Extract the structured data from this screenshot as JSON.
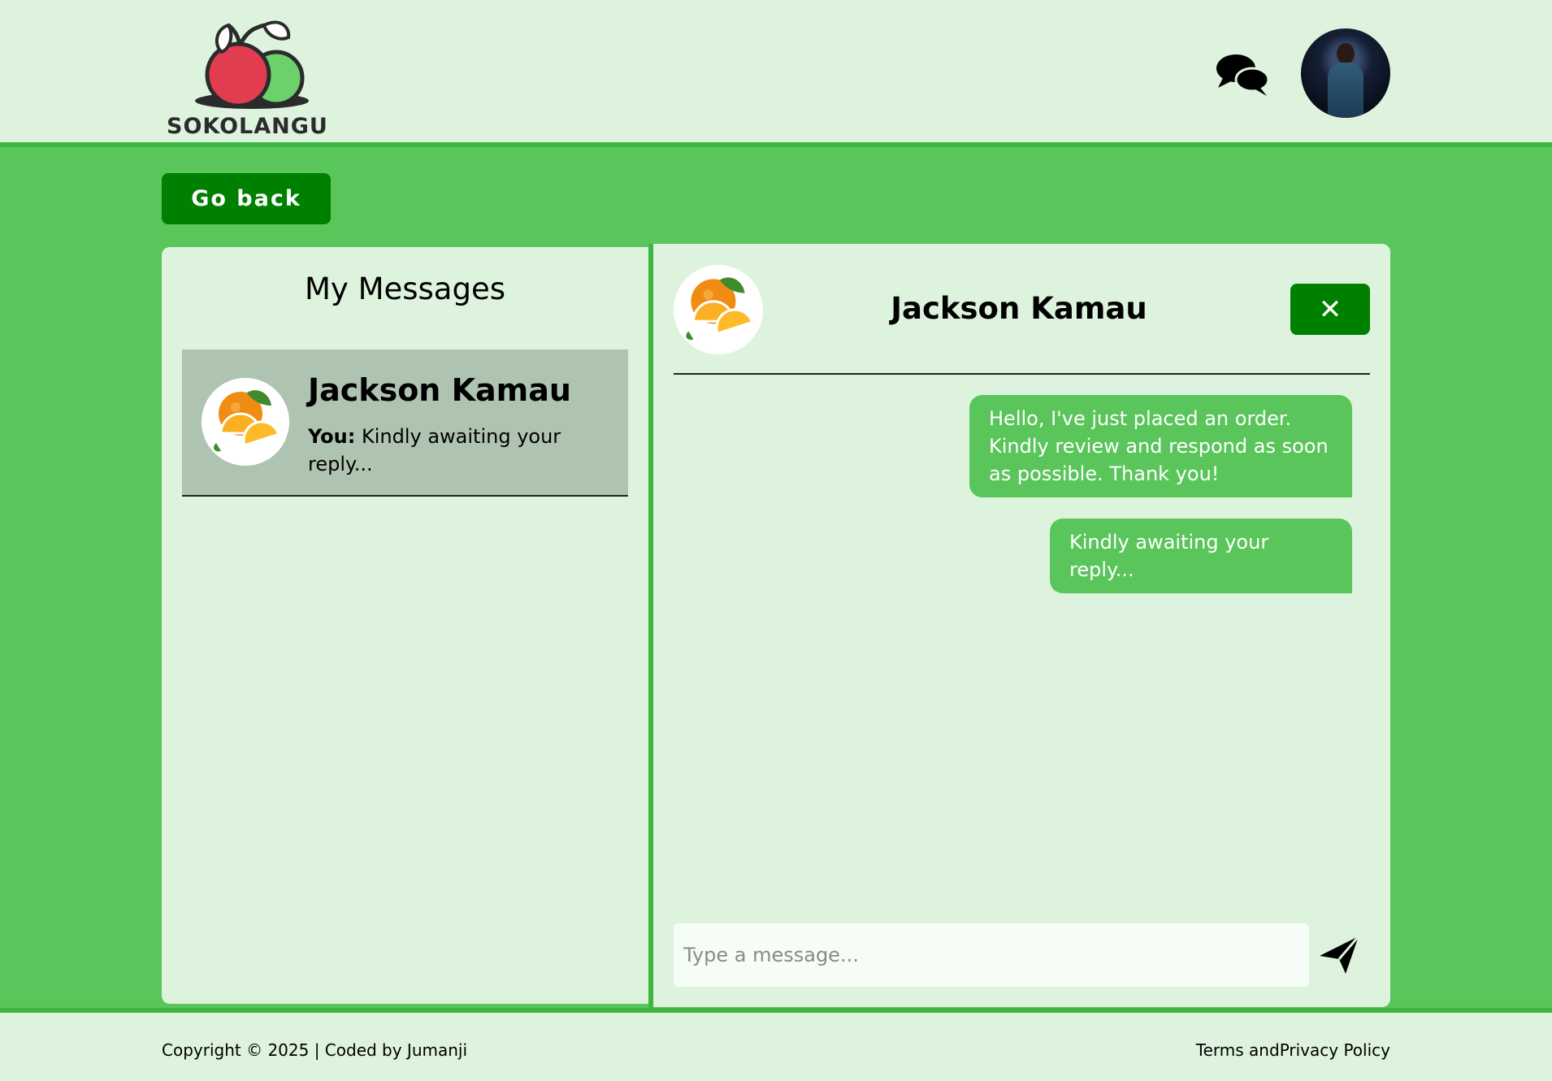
{
  "header": {
    "logo_text": "SOKOLANGU"
  },
  "nav": {
    "go_back_label": "Go back"
  },
  "sidebar": {
    "title": "My Messages",
    "conversations": [
      {
        "name": "Jackson Kamau",
        "preview_prefix": "You:",
        "preview_text": " Kindly awaiting your reply..."
      }
    ]
  },
  "chat": {
    "title": "Jackson Kamau",
    "close_label": "✕",
    "messages": [
      {
        "text": "Hello, I've just placed an order. Kindly review and respond as soon as possible. Thank you!"
      },
      {
        "text": "Kindly awaiting your reply..."
      }
    ],
    "input_placeholder": "Type a message..."
  },
  "footer": {
    "copyright": "Copyright © 2025 | Coded by Jumanji",
    "terms_label": "Terms and",
    "privacy_label": "Privacy Policy"
  },
  "colors": {
    "page_green": "#5ac55a",
    "panel_bg": "#ddf3dd",
    "button_green": "#008000",
    "selected_item": "#aec3b0"
  },
  "icons": {
    "chat": "chat-bubbles-icon",
    "send": "send-plane-icon",
    "close": "close-icon"
  }
}
